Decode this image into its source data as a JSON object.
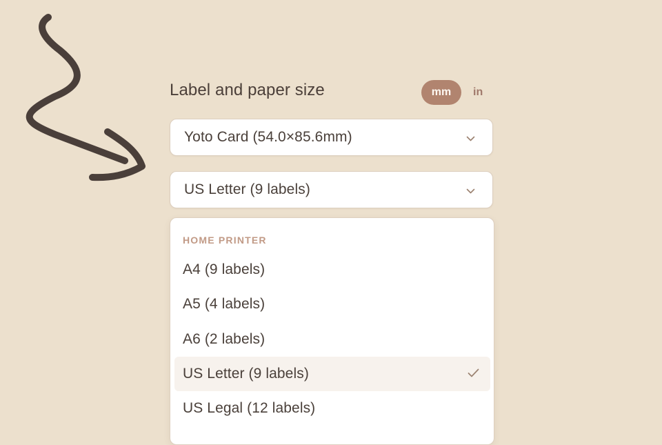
{
  "header": {
    "title": "Label and paper size"
  },
  "units": {
    "options": [
      "mm",
      "in"
    ],
    "selected": "mm"
  },
  "label_select": {
    "value": "Yoto Card (54.0×85.6mm)"
  },
  "paper_select": {
    "value": "US Letter (9 labels)"
  },
  "dropdown": {
    "group_label": "HOME PRINTER",
    "items": [
      {
        "label": "A4 (9 labels)",
        "selected": false
      },
      {
        "label": "A5 (4 labels)",
        "selected": false
      },
      {
        "label": "A6 (2 labels)",
        "selected": false
      },
      {
        "label": "US Letter (9 labels)",
        "selected": true
      },
      {
        "label": "US Legal (12 labels)",
        "selected": false
      }
    ]
  },
  "icons": {
    "chevron": "chevron-down-icon",
    "check": "checkmark-icon",
    "arrow": "hand-drawn-arrow-icon"
  },
  "colors": {
    "background": "#ece0cd",
    "accent": "#b1846f",
    "text": "#4a403a",
    "group_label": "#c19a86",
    "selected_option": "#f7f2ed",
    "arrow": "#4a3f3a"
  }
}
